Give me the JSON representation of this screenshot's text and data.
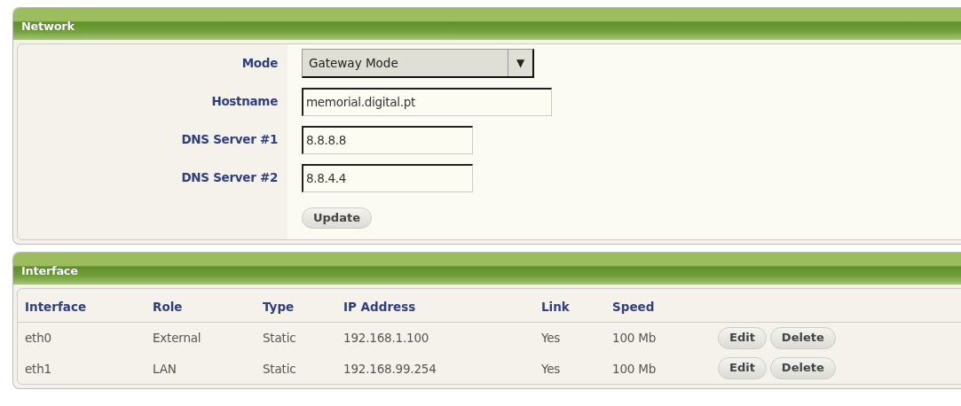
{
  "network": {
    "title": "Network",
    "fields": [
      {
        "label": "Mode",
        "kind": "select",
        "value": "Gateway Mode",
        "arrow": "▼"
      },
      {
        "label": "Hostname",
        "kind": "text",
        "value": "memorial.digital.pt"
      },
      {
        "label": "DNS Server #1",
        "kind": "text",
        "value": "8.8.8.8"
      },
      {
        "label": "DNS Server #2",
        "kind": "text",
        "value": "8.8.4.4"
      }
    ],
    "button": "Update"
  },
  "interface": {
    "title": "Interface",
    "columns": [
      "Interface",
      "Role",
      "Type",
      "IP Address",
      "Link",
      "Speed"
    ],
    "rows": [
      {
        "cells": [
          "eth0",
          "External",
          "Static",
          "192.168.1.100",
          "Yes",
          "100 Mb"
        ],
        "actions": [
          "Edit",
          "Delete"
        ]
      },
      {
        "cells": [
          "eth1",
          "LAN",
          "Static",
          "192.168.99.254",
          "Yes",
          "100 Mb"
        ],
        "actions": [
          "Edit",
          "Delete"
        ]
      }
    ]
  }
}
